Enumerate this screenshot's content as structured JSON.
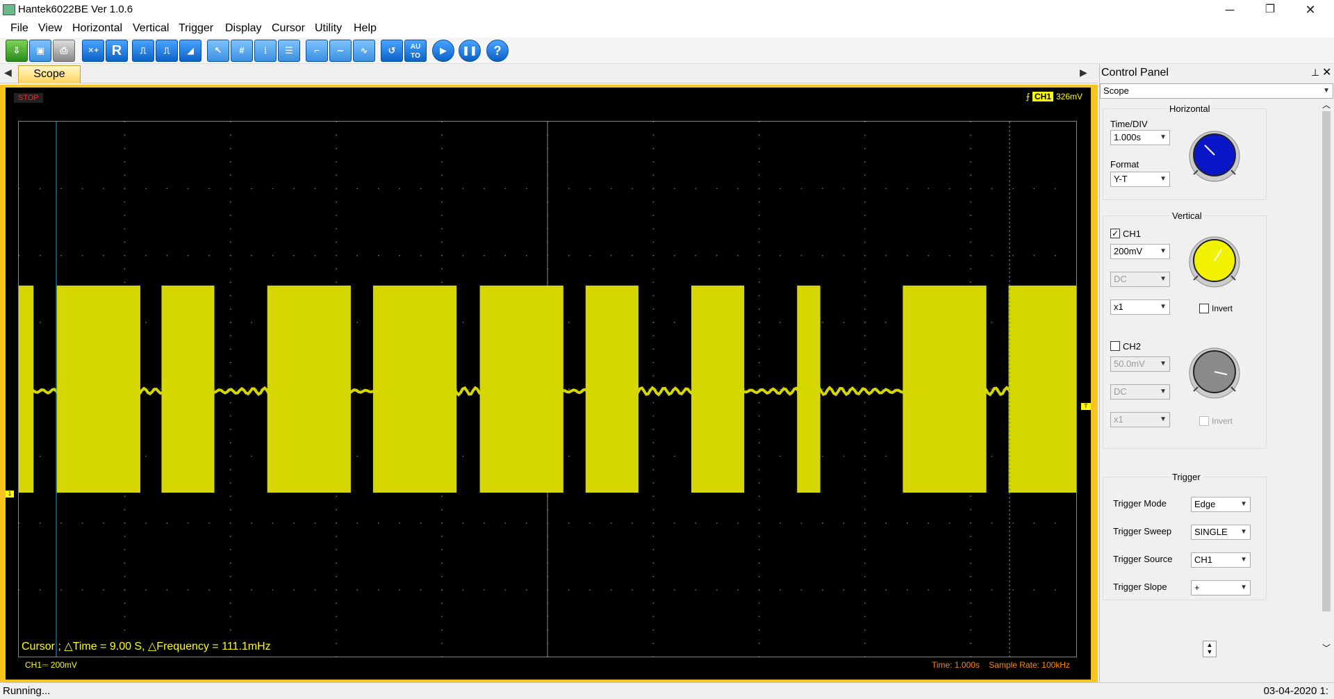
{
  "window": {
    "title": "Hantek6022BE Ver 1.0.6",
    "minimize": "─",
    "maximize": "❐",
    "close": "✕"
  },
  "menu": [
    "File",
    "View",
    "Horizontal",
    "Vertical",
    "Trigger",
    "Display",
    "Cursor",
    "Utility",
    "Help"
  ],
  "toolbar": {
    "icons": [
      "open-icon",
      "save-icon",
      "print-icon",
      "cursor-xy-icon",
      "r-icon",
      "pulse-icon",
      "pulse-edge-icon",
      "ramp-icon",
      "select-arrow-icon",
      "grid-icon",
      "vertical-lines-icon",
      "horizontal-lines-icon",
      "step-icon",
      "wave-icon",
      "sine-icon",
      "undo-icon",
      "auto-icon",
      "play-icon",
      "pause-icon",
      "help-icon"
    ],
    "auto_label": "AU TO",
    "r_label": "R"
  },
  "tab": {
    "label": "Scope"
  },
  "scope": {
    "state": "STOP",
    "trigger_channel": "CH1",
    "trigger_level": "326mV",
    "cursor_text": "Cursor ; △Time = 9.00 S, △Frequency = 111.1mHz",
    "ch_info": "CH1⎓  200mV",
    "time_info": "Time: 1.000s",
    "sample_rate": "Sample Rate: 100kHz",
    "trace_color": "#d7d700",
    "cursor_color": "#1fa3d6",
    "ch1_marker": "1",
    "trigger_marker": "T"
  },
  "control_panel": {
    "title": "Control Panel",
    "selector": "Scope",
    "horizontal": {
      "label": "Horizontal",
      "time_div_label": "Time/DIV",
      "time_div": "1.000s",
      "format_label": "Format",
      "format": "Y-T",
      "knob_color": "#0b16c8"
    },
    "vertical": {
      "label": "Vertical",
      "ch1_label": "CH1",
      "ch1_checked": "✓",
      "ch1_volts": "200mV",
      "ch1_coupling": "DC",
      "ch1_probe": "x1",
      "ch1_invert": "Invert",
      "ch1_knob_color": "#f2f200",
      "ch2_label": "CH2",
      "ch2_volts": "50.0mV",
      "ch2_coupling": "DC",
      "ch2_probe": "x1",
      "ch2_invert": "Invert",
      "ch2_knob_color": "#8a8a8a"
    },
    "trigger": {
      "label": "Trigger",
      "mode_label": "Trigger Mode",
      "mode": "Edge",
      "sweep_label": "Trigger Sweep",
      "sweep": "SINGLE",
      "source_label": "Trigger Source",
      "source": "CH1",
      "slope_label": "Trigger Slope",
      "slope": "+"
    }
  },
  "status": {
    "left": "Running...",
    "right": "03-04-2020  1:"
  }
}
